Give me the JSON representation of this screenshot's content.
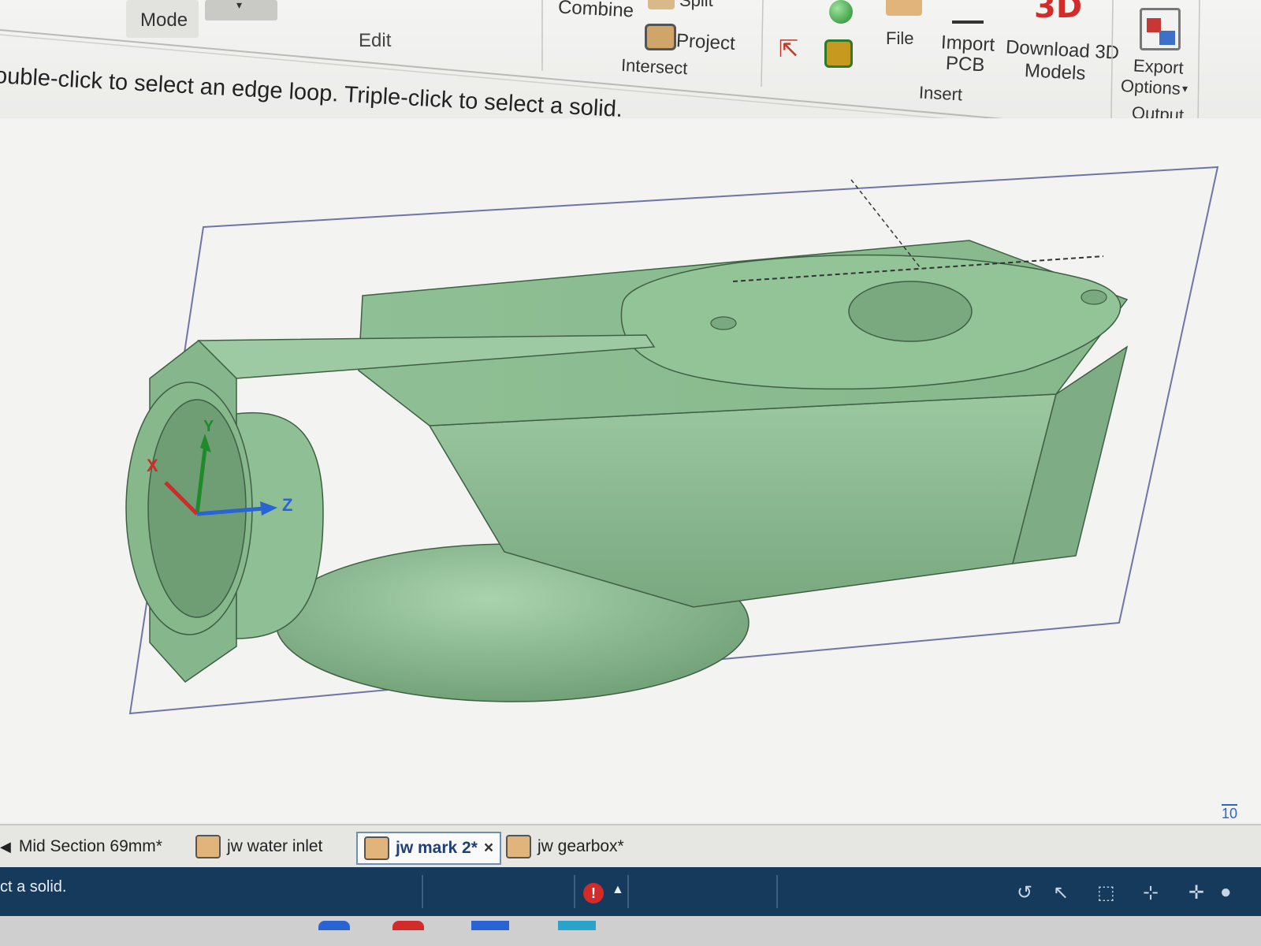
{
  "ribbon": {
    "mode_label": "Mode",
    "edit_group": "Edit",
    "combine_label": "Combine",
    "split_label": "Split",
    "project_label": "Project",
    "intersect_label": "Intersect",
    "file_label": "File",
    "import_pcb_line1": "Import",
    "import_pcb_line2": "PCB",
    "download_line1": "Download 3D",
    "download_line2": "Models",
    "download_logo": "3D",
    "insert_group": "Insert",
    "export_line1": "Export",
    "export_line2": "Options",
    "output_group": "Output"
  },
  "viewport": {
    "hint_text": "ouble-click to select an edge loop. Triple-click to select a solid.",
    "axes": {
      "x": "X",
      "y": "Y",
      "z": "Z"
    },
    "corner_label": "10",
    "model_color": "#8fbf94"
  },
  "doc_tabs": [
    {
      "label": "Mid Section 69mm*",
      "active": false
    },
    {
      "label": "jw water inlet",
      "active": false
    },
    {
      "label": "jw mark 2*",
      "active": true,
      "close": "×"
    },
    {
      "label": "jw gearbox*",
      "active": false
    }
  ],
  "status": {
    "message": "ct a solid.",
    "alert_icon": "!"
  },
  "colors": {
    "status_bar": "#163a5c",
    "accent_red": "#d32a2a",
    "model_green": "#8fbf94"
  }
}
